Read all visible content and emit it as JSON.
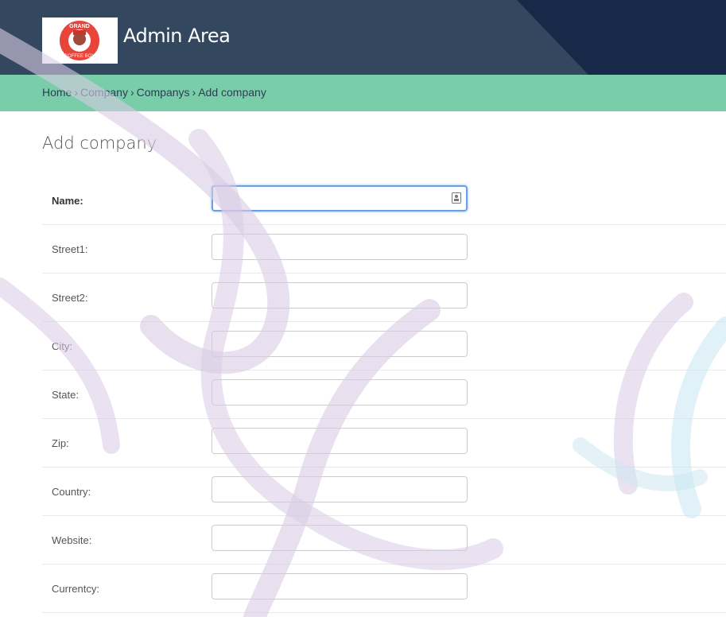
{
  "header": {
    "site_title": "Admin Area",
    "logo_text_top": "GRAND",
    "logo_text_bottom": "COFFEE BOY",
    "colors": {
      "primary": "#33475f",
      "dark": "#172849",
      "accent": "#79cda8"
    }
  },
  "breadcrumbs": {
    "items": [
      "Home",
      "Company",
      "Companys",
      "Add company"
    ],
    "separator": "›"
  },
  "page": {
    "title": "Add company"
  },
  "form": {
    "fields": [
      {
        "label": "Name:",
        "value": "",
        "required": true
      },
      {
        "label": "Street1:",
        "value": ""
      },
      {
        "label": "Street2:",
        "value": ""
      },
      {
        "label": "City:",
        "value": ""
      },
      {
        "label": "State:",
        "value": ""
      },
      {
        "label": "Zip:",
        "value": ""
      },
      {
        "label": "Country:",
        "value": ""
      },
      {
        "label": "Website:",
        "value": ""
      },
      {
        "label": "Currentcy:",
        "value": ""
      }
    ]
  }
}
